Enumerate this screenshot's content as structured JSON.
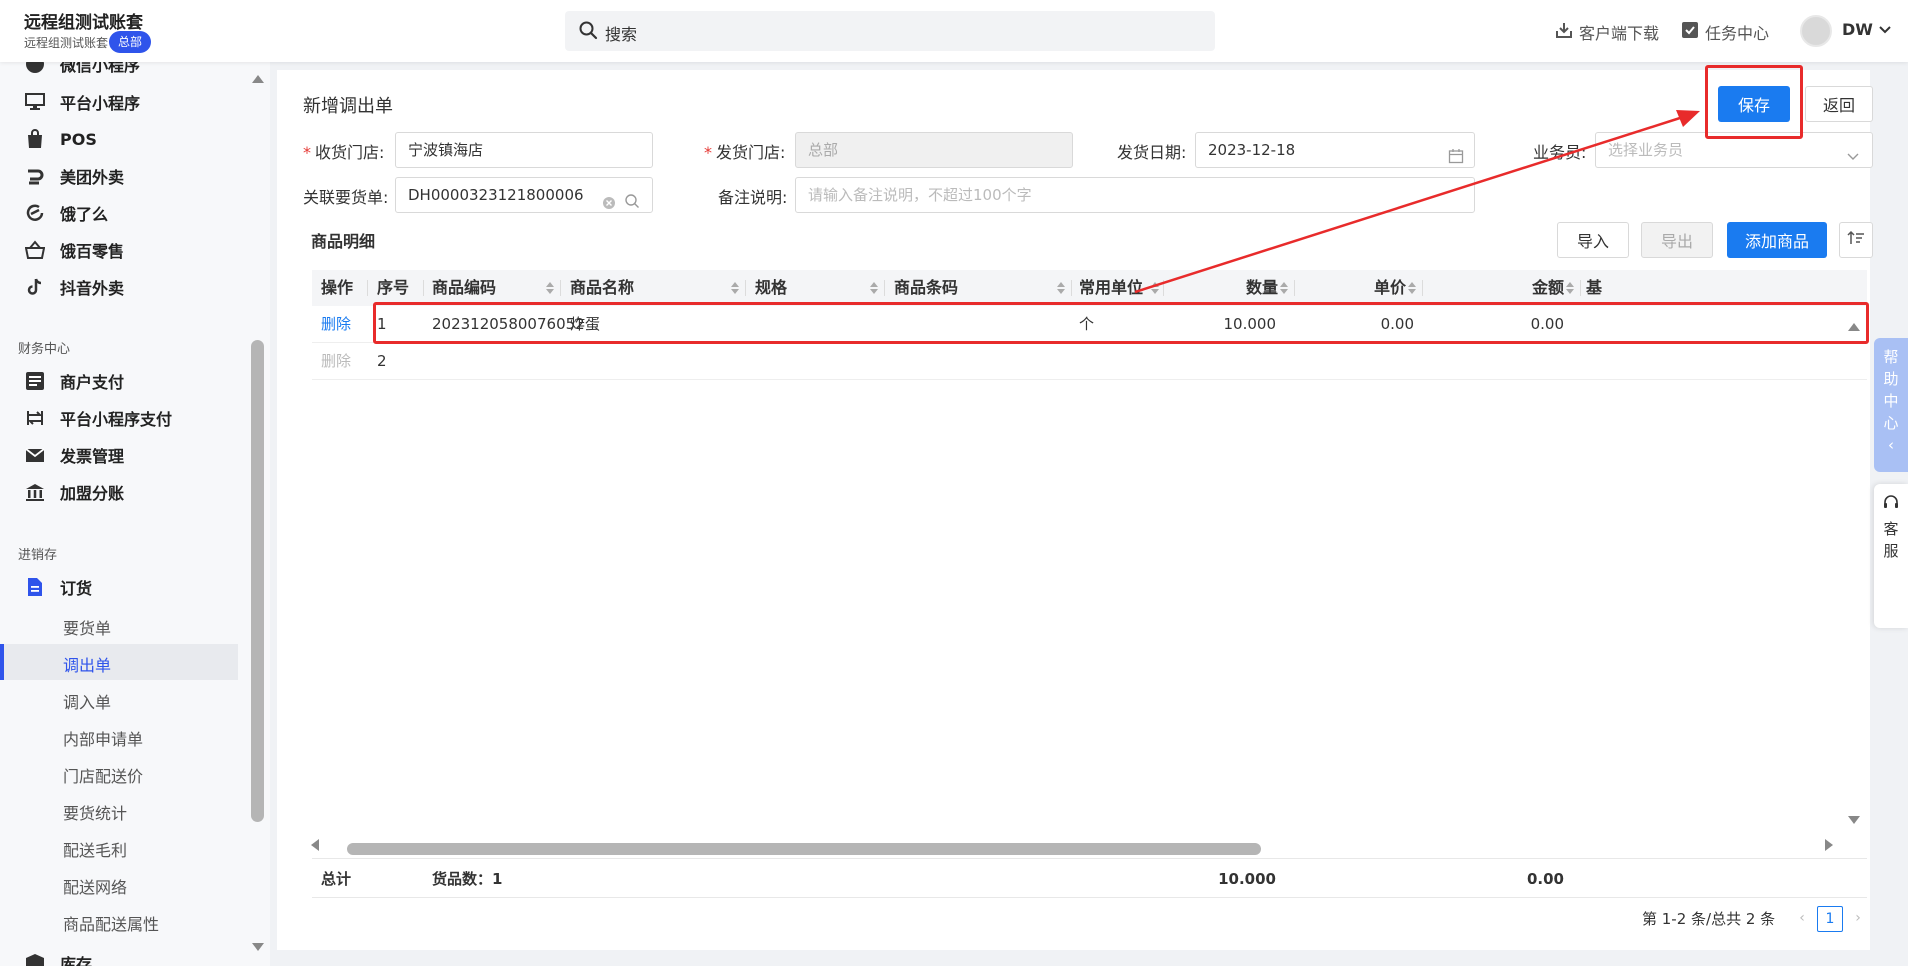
{
  "header": {
    "title": "远程组测试账套",
    "subtitle": "远程组测试账套",
    "badge": "总部",
    "search_placeholder": "搜索",
    "download": "客户端下载",
    "tasks": "任务中心",
    "user": "DW"
  },
  "sidebar": {
    "top_items": [
      {
        "label": "微信小程序",
        "icon": "tiktok-icon"
      },
      {
        "label": "平台小程序",
        "icon": "monitor-icon"
      },
      {
        "label": "POS",
        "icon": "shopping-bag-icon"
      },
      {
        "label": "美团外卖",
        "icon": "meituan-icon"
      },
      {
        "label": "饿了么",
        "icon": "eleme-icon"
      },
      {
        "label": "饿百零售",
        "icon": "basket-icon"
      },
      {
        "label": "抖音外卖",
        "icon": "tiktok-icon"
      }
    ],
    "finance_group": "财务中心",
    "finance_items": [
      {
        "label": "商户支付",
        "icon": "list-icon"
      },
      {
        "label": "平台小程序支付",
        "icon": "transfer-icon"
      },
      {
        "label": "发票管理",
        "icon": "mail-icon"
      },
      {
        "label": "加盟分账",
        "icon": "bank-icon"
      }
    ],
    "inventory_group": "进销存",
    "order_item": "订货",
    "sub_items": [
      "要货单",
      "调出单",
      "调入单",
      "内部申请单",
      "门店配送价",
      "要货统计",
      "配送毛利",
      "配送网络",
      "商品配送属性"
    ],
    "bottom_item": "库存"
  },
  "page": {
    "title": "新增调出单",
    "save": "保存",
    "back": "返回",
    "form": {
      "receive_store_label": "收货门店:",
      "receive_store_value": "宁波镇海店",
      "send_store_label": "发货门店:",
      "send_store_value": "总部",
      "send_date_label": "发货日期:",
      "send_date_value": "2023-12-18",
      "salesman_label": "业务员:",
      "salesman_placeholder": "选择业务员",
      "related_order_label": "关联要货单:",
      "related_order_value": "DH0000323121800006",
      "remark_label": "备注说明:",
      "remark_placeholder": "请输入备注说明，不超过100个字"
    },
    "detail_title": "商品明细",
    "import": "导入",
    "export": "导出",
    "add_goods": "添加商品",
    "table": {
      "headers": [
        "操作",
        "序号",
        "商品编码",
        "商品名称",
        "规格",
        "商品条码",
        "常用单位",
        "数量",
        "单价",
        "金额",
        "基"
      ],
      "rows": [
        {
          "action": "删除",
          "no": "1",
          "code": "2023120580076052",
          "name": "炸蛋",
          "spec": "",
          "barcode": "",
          "unit": "个",
          "qty": "10.000",
          "price": "0.00",
          "amount": "0.00"
        },
        {
          "action": "删除",
          "no": "2",
          "code": "",
          "name": "",
          "spec": "",
          "barcode": "",
          "unit": "",
          "qty": "",
          "price": "",
          "amount": ""
        }
      ],
      "total_label": "总计",
      "goods_count": "货品数：1",
      "total_qty": "10.000",
      "total_amount": "0.00"
    },
    "pager": {
      "summary": "第 1-2 条/总共 2 条",
      "current": "1"
    }
  },
  "floating": {
    "help": [
      "帮",
      "助",
      "中",
      "心",
      "‹"
    ],
    "service": [
      "客",
      "服"
    ]
  },
  "colors": {
    "primary": "#1a7bf0",
    "annotation": "#e82b2b",
    "badge": "#2f54eb"
  }
}
